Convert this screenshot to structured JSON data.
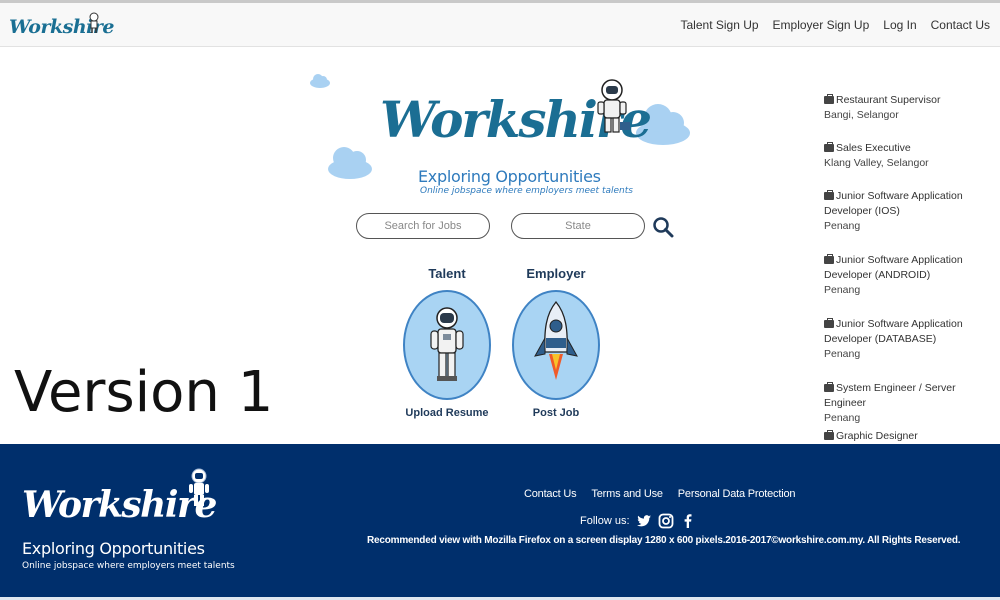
{
  "brand": {
    "name": "Workshire",
    "tagline": "Exploring Opportunities",
    "subtagline": "Online jobspace where employers meet talents",
    "primary_color": "#1b6e93",
    "accent_color": "#3f83c4",
    "footer_color": "#002f6c"
  },
  "nav": {
    "links": [
      "Talent Sign Up",
      "Employer Sign Up",
      "Log In",
      "Contact Us"
    ]
  },
  "search": {
    "jobs_placeholder": "Search for Jobs",
    "state_placeholder": "State",
    "button_icon": "search-icon"
  },
  "roles": {
    "talent": {
      "title": "Talent",
      "action": "Upload Resume",
      "icon": "astronaut-icon"
    },
    "employer": {
      "title": "Employer",
      "action": "Post Job",
      "icon": "rocket-icon"
    }
  },
  "overlay_label": "Version 1",
  "jobs": [
    {
      "title": "Restaurant Supervisor",
      "location": "Bangi, Selangor"
    },
    {
      "title": "Sales Executive",
      "location": "Klang Valley, Selangor"
    },
    {
      "title": "Junior Software Application Developer (IOS)",
      "location": "Penang"
    },
    {
      "title": "Junior Software Application Developer (ANDROID)",
      "location": "Penang"
    },
    {
      "title": "Junior Software Application Developer (DATABASE)",
      "location": "Penang"
    },
    {
      "title": "System Engineer / Server Engineer",
      "location": "Penang"
    },
    {
      "title": "Graphic Designer",
      "location": ""
    }
  ],
  "footer": {
    "links": [
      "Contact Us",
      "Terms and Use",
      "Personal Data Protection"
    ],
    "follow_label": "Follow us:",
    "social_icons": [
      "twitter-icon",
      "instagram-icon",
      "facebook-icon"
    ],
    "copyright": "Recommended view with Mozilla Firefox on a screen display 1280 x 600 pixels.2016-2017©workshire.com.my. All Rights Reserved."
  }
}
